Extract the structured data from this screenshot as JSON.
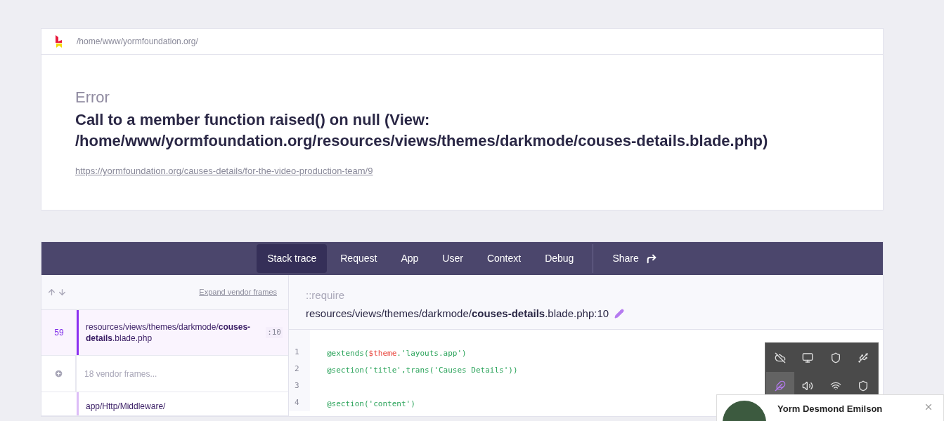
{
  "header": {
    "path": "/home/www/yormfoundation.org/"
  },
  "error": {
    "label": "Error",
    "message": "Call to a member function raised() on null (View: /home/www/yormfoundation.org/resources/views/themes/darkmode/couses-details.blade.php)",
    "url": "https://yormfoundation.org/causes-details/for-the-video-production-team/9"
  },
  "tabs": [
    {
      "label": "Stack trace",
      "selected": true
    },
    {
      "label": "Request",
      "selected": false
    },
    {
      "label": "App",
      "selected": false
    },
    {
      "label": "User",
      "selected": false
    },
    {
      "label": "Context",
      "selected": false
    },
    {
      "label": "Debug",
      "selected": false
    }
  ],
  "share": {
    "label": "Share"
  },
  "frames_toolbar": {
    "expand_link": "Expand vendor frames"
  },
  "frames": [
    {
      "kind": "app",
      "number": "59",
      "path": "resources/views/themes/darkmode/**couses-details**.blade.php",
      "line": ":10",
      "selected": true
    },
    {
      "kind": "vendor",
      "label": "18 vendor frames..."
    },
    {
      "kind": "app",
      "path": "app/Http/Middleware/",
      "selected": false
    }
  ],
  "source": {
    "method": "::require",
    "file": "resources/views/themes/darkmode/**couses-details**.blade.php:10"
  },
  "code_lines": [
    {
      "number": "1",
      "tokens": [
        {
          "text": "@extends(",
          "kind": "plain"
        },
        {
          "text": "$theme",
          "kind": "variable"
        },
        {
          "text": ".'layouts.app')",
          "kind": "plain"
        }
      ]
    },
    {
      "number": "2",
      "tokens": [
        {
          "text": "@section('title',trans('Causes Details'))",
          "kind": "plain"
        }
      ]
    },
    {
      "number": "3"
    },
    {
      "number": "4",
      "tokens": [
        {
          "text": "@section('content')",
          "kind": "plain"
        }
      ]
    }
  ],
  "tray_icons": [
    {
      "selected": false
    },
    {
      "selected": false
    },
    {
      "selected": false
    },
    {
      "selected": false
    },
    {
      "selected": true
    },
    {
      "selected": false
    },
    {
      "selected": false
    },
    {
      "selected": false
    }
  ],
  "notification": {
    "name": "Yorm Desmond Emilson"
  }
}
